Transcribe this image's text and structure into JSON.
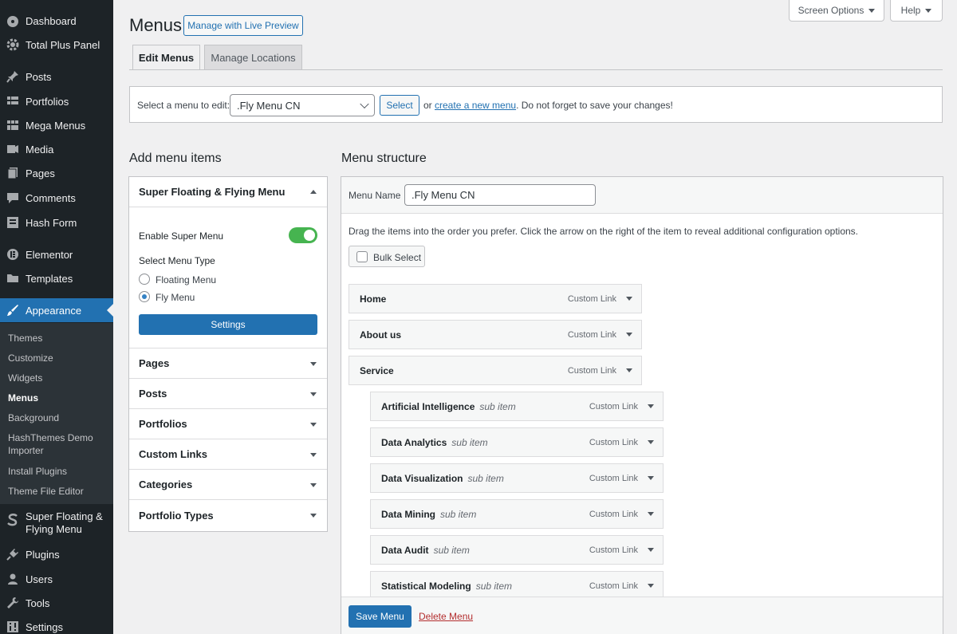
{
  "sidebar": {
    "items": [
      {
        "label": "Dashboard",
        "icon": "dashboard-icon"
      },
      {
        "label": "Total Plus Panel",
        "icon": "gear-icon"
      },
      {
        "label": "Posts",
        "icon": "pin-icon"
      },
      {
        "label": "Portfolios",
        "icon": "grid-icon"
      },
      {
        "label": "Mega Menus",
        "icon": "grid-icon"
      },
      {
        "label": "Media",
        "icon": "media-icon"
      },
      {
        "label": "Pages",
        "icon": "page-icon"
      },
      {
        "label": "Comments",
        "icon": "comment-icon"
      },
      {
        "label": "Hash Form",
        "icon": "form-icon"
      },
      {
        "label": "Elementor",
        "icon": "elementor-icon"
      },
      {
        "label": "Templates",
        "icon": "folder-icon"
      },
      {
        "label": "Appearance",
        "icon": "brush-icon"
      },
      {
        "label": "Super Floating & Flying Menu",
        "icon": "s-icon"
      },
      {
        "label": "Plugins",
        "icon": "plug-icon"
      },
      {
        "label": "Users",
        "icon": "user-icon"
      },
      {
        "label": "Tools",
        "icon": "wrench-icon"
      },
      {
        "label": "Settings",
        "icon": "settings-icon"
      }
    ],
    "submenu": [
      "Themes",
      "Customize",
      "Widgets",
      "Menus",
      "Background",
      "HashThemes Demo Importer",
      "Install Plugins",
      "Theme File Editor"
    ]
  },
  "header": {
    "title": "Menus",
    "live_preview": "Manage with Live Preview",
    "screen_options": "Screen Options",
    "help": "Help"
  },
  "tabs": [
    "Edit Menus",
    "Manage Locations"
  ],
  "select_bar": {
    "label": "Select a menu to edit:",
    "selected": ".Fly Menu CN",
    "select_button": "Select",
    "or": "or",
    "create_link": "create a new menu",
    "note": ". Do not forget to save your changes!"
  },
  "add_items": {
    "heading": "Add menu items",
    "super_menu_title": "Super Floating & Flying Menu",
    "enable_label": "Enable Super Menu",
    "enabled": true,
    "type_label": "Select Menu Type",
    "types": [
      "Floating Menu",
      "Fly Menu"
    ],
    "selected_type": "Fly Menu",
    "settings_button": "Settings",
    "sections": [
      "Pages",
      "Posts",
      "Portfolios",
      "Custom Links",
      "Categories",
      "Portfolio Types"
    ]
  },
  "structure": {
    "heading": "Menu structure",
    "name_label": "Menu Name",
    "name_value": ".Fly Menu CN",
    "instructions": "Drag the items into the order you prefer. Click the arrow on the right of the item to reveal additional configuration options.",
    "bulk_select": "Bulk Select",
    "items": [
      {
        "title": "Home",
        "sub": "",
        "type": "Custom Link"
      },
      {
        "title": "About us",
        "sub": "",
        "type": "Custom Link"
      },
      {
        "title": "Service",
        "sub": "",
        "type": "Custom Link"
      },
      {
        "title": "Artificial Intelligence",
        "sub": "sub item",
        "type": "Custom Link"
      },
      {
        "title": "Data Analytics",
        "sub": "sub item",
        "type": "Custom Link"
      },
      {
        "title": "Data Visualization",
        "sub": "sub item",
        "type": "Custom Link"
      },
      {
        "title": "Data Mining",
        "sub": "sub item",
        "type": "Custom Link"
      },
      {
        "title": "Data Audit",
        "sub": "sub item",
        "type": "Custom Link"
      },
      {
        "title": "Statistical Modeling",
        "sub": "sub item",
        "type": "Custom Link"
      }
    ],
    "save_button": "Save Menu",
    "delete_link": "Delete Menu"
  },
  "colors": {
    "sidebar_bg": "#1d2327",
    "accent": "#2271b1",
    "toggle_on": "#46b450",
    "delete": "#b32d2e"
  }
}
